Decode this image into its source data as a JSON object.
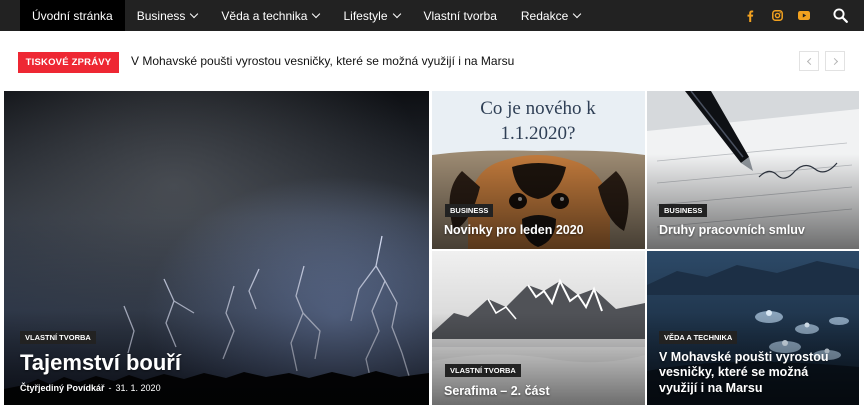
{
  "nav": {
    "items": [
      {
        "label": "Úvodní stránka",
        "active": true,
        "dropdown": false
      },
      {
        "label": "Business",
        "dropdown": true
      },
      {
        "label": "Věda a technika",
        "dropdown": true
      },
      {
        "label": "Lifestyle",
        "dropdown": true
      },
      {
        "label": "Vlastní tvorba",
        "dropdown": false
      },
      {
        "label": "Redakce",
        "dropdown": true
      }
    ],
    "social_icons": [
      "facebook-icon",
      "instagram-icon",
      "youtube-icon"
    ],
    "social_color": "#f2a11f",
    "search_icon": "search-icon",
    "background": "#222222"
  },
  "ticker": {
    "label": "TISKOVÉ ZPRÁVY",
    "label_color": "#ee2733",
    "headline": "V Mohavské poušti vyrostou vesničky, které se možná využijí i na Marsu",
    "prev_icon": "chevron-left-icon",
    "next_icon": "chevron-right-icon"
  },
  "tiles": {
    "main": {
      "category": "VLASTNÍ TVORBA",
      "title": "Tajemství bouří",
      "author": "Čtyřjediný Povídkář",
      "separator": "-",
      "date": "31. 1. 2020",
      "image": "storm-lightning-image"
    },
    "top_middle": {
      "category": "BUSINESS",
      "title": "Novinky pro leden 2020",
      "image_caption": [
        "Co je nového k",
        "1.1.2020?"
      ],
      "image": "dog-image"
    },
    "top_right": {
      "category": "BUSINESS",
      "title": "Druhy pracovních smluv",
      "image": "pen-signature-image"
    },
    "bottom_middle": {
      "category": "VLASTNÍ TVORBA",
      "title": "Serafima – 2. část",
      "image": "mountains-image"
    },
    "bottom_right": {
      "category": "VĚDA A TECHNIKA",
      "title": "V Mohavské poušti vyrostou vesničky, které se možná využijí i na Marsu",
      "image": "desert-pods-image"
    }
  }
}
